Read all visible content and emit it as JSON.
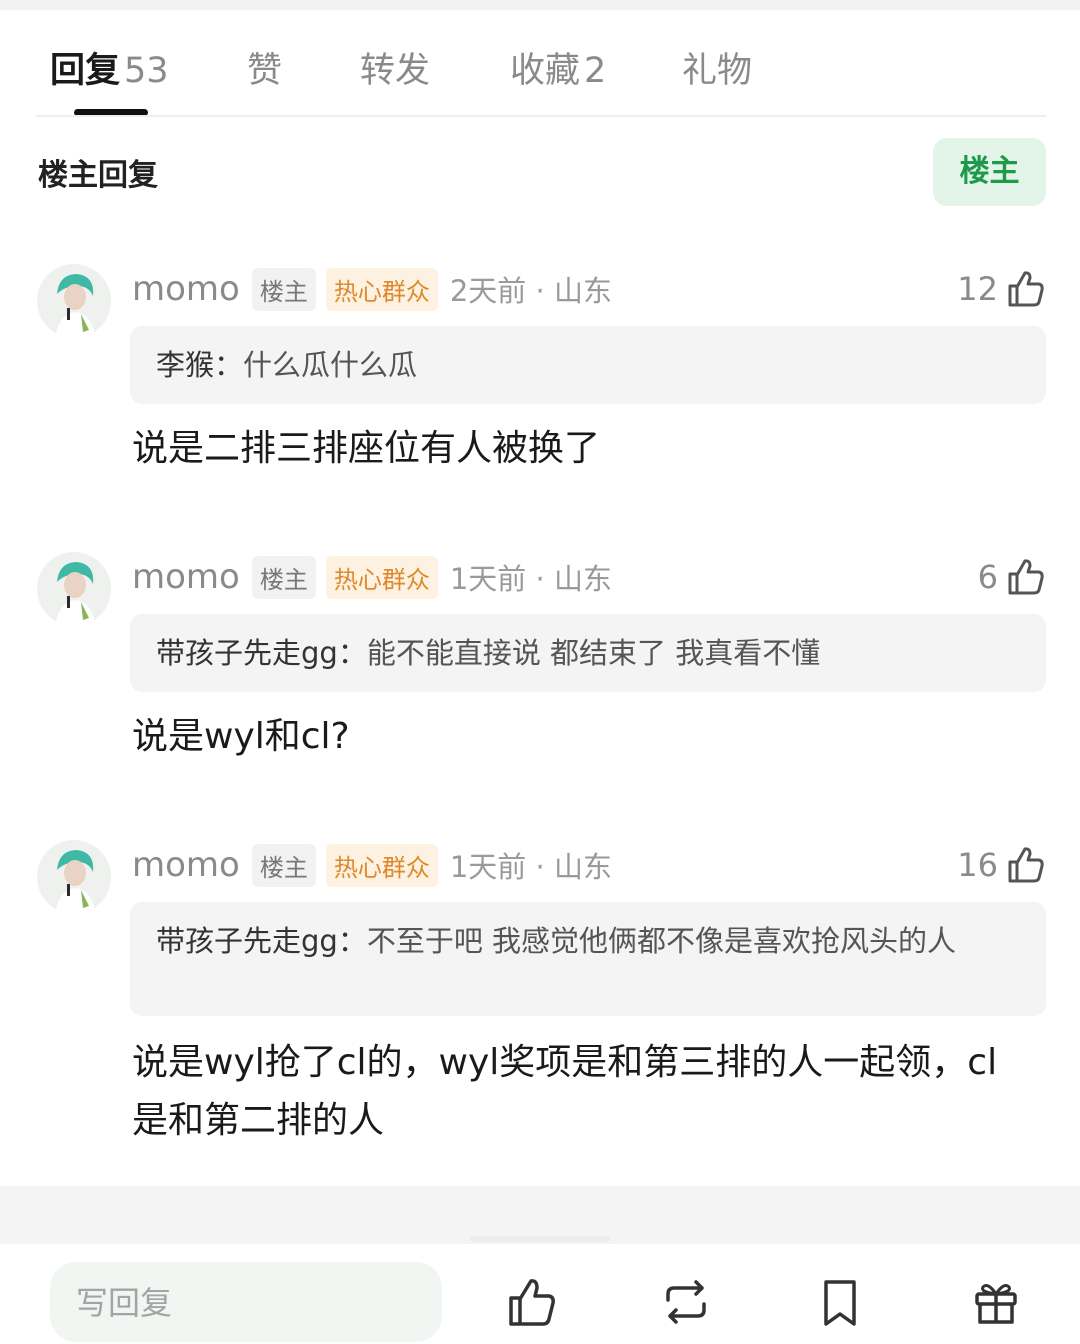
{
  "tabs": [
    {
      "label": "回复",
      "count": "53"
    },
    {
      "label": "赞",
      "count": ""
    },
    {
      "label": "转发",
      "count": ""
    },
    {
      "label": "收藏",
      "count": "2"
    },
    {
      "label": "礼物",
      "count": ""
    }
  ],
  "section": {
    "title": "楼主回复",
    "filter_label": "楼主"
  },
  "comments": [
    {
      "user": "momo",
      "badge_owner": "楼主",
      "badge_hot": "热心群众",
      "time": "2天前 · 山东",
      "likes": "12",
      "quote_user": "李猴：",
      "quote_text": "什么瓜什么瓜",
      "text": "说是二排三排座位有人被换了"
    },
    {
      "user": "momo",
      "badge_owner": "楼主",
      "badge_hot": "热心群众",
      "time": "1天前 · 山东",
      "likes": "6",
      "quote_user": "带孩子先走gg：",
      "quote_text": "能不能直接说 都结束了 我真看不懂",
      "text": "说是wyl和cl?"
    },
    {
      "user": "momo",
      "badge_owner": "楼主",
      "badge_hot": "热心群众",
      "time": "1天前 · 山东",
      "likes": "16",
      "quote_user": "带孩子先走gg：",
      "quote_text": "不至于吧 我感觉他俩都不像是喜欢抢风头的人",
      "text": "说是wyl抢了cl的，wyl奖项是和第三排的人一起领，cl是和第二排的人"
    }
  ],
  "bottom_bar": {
    "reply_placeholder": "写回复",
    "icons": [
      "thumbs-up-icon",
      "repost-icon",
      "bookmark-icon",
      "gift-icon"
    ]
  },
  "colors": {
    "accent_green": "#1f9a4a",
    "hot_badge": "#e0892a"
  }
}
